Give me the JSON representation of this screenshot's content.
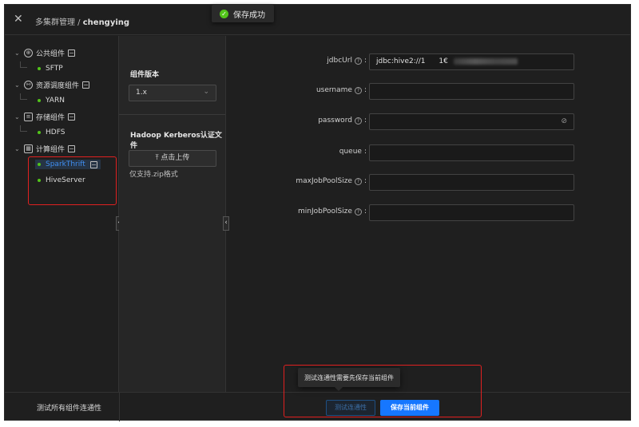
{
  "header": {
    "close_icon": "close-icon",
    "title_main": "多集群管理",
    "separator": " / ",
    "cluster_name": "chengying"
  },
  "toast": {
    "text": "保存成功",
    "icon": "check-circle-icon",
    "color": "#52c41a"
  },
  "tree": {
    "groups": [
      {
        "label": "公共组件",
        "icon": "globe-icon",
        "children": [
          "SFTP"
        ]
      },
      {
        "label": "资源调度组件",
        "icon": "cluster-icon",
        "children": [
          "YARN"
        ]
      },
      {
        "label": "存储组件",
        "icon": "database-icon",
        "children": [
          "HDFS"
        ]
      },
      {
        "label": "计算组件",
        "icon": "compute-icon",
        "children": [
          "SparkThrift",
          "HiveServer"
        ]
      }
    ],
    "active_item": "SparkThrift",
    "active_color": "#3f8ef0"
  },
  "version_panel": {
    "version_label": "组件版本",
    "version_value": "1.x",
    "kerberos_label": "Hadoop Kerberos认证文件",
    "upload_label": "点击上传",
    "upload_hint": "仅支持.zip格式"
  },
  "form": {
    "fields": [
      {
        "label": "jdbcUrl",
        "value": "jdbc:hive2://1",
        "value_tail": "1€",
        "has_help": true
      },
      {
        "label": "username",
        "value": "",
        "has_help": true
      },
      {
        "label": "password",
        "value": "",
        "has_help": true,
        "icon": "eye-invisible-icon"
      },
      {
        "label": "queue",
        "value": "",
        "has_help": false
      },
      {
        "label": "maxJobPoolSize",
        "value": "",
        "has_help": true
      },
      {
        "label": "minJobPoolSize",
        "value": "",
        "has_help": true
      }
    ]
  },
  "footer": {
    "test_all_label": "测试所有组件连通性",
    "tooltip": "测试连通性需要先保存当前组件",
    "test_button": "测试连通性",
    "save_button": "保存当前组件",
    "primary_color": "#1677ff"
  }
}
